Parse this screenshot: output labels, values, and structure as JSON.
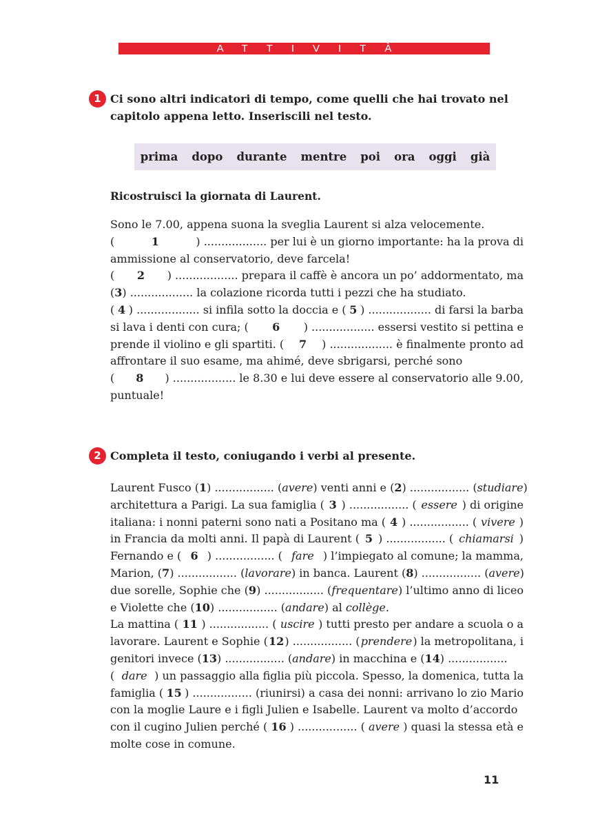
{
  "header": {
    "banner": "ATTIVITÀ"
  },
  "exercise1": {
    "number": "1",
    "title_line1": "Ci sono altri indicatori di tempo, come quelli che hai trovato nel",
    "title_line2": "capitolo appena letto. Inseriscili nel testo.",
    "words": [
      "prima",
      "dopo",
      "durante",
      "mentre",
      "poi",
      "ora",
      "oggi",
      "già"
    ],
    "subtitle": "Ricostruisci la giornata di Laurent.",
    "text_lines": [
      "Sono le 7.00, appena suona la sveglia Laurent si alza velocemente.",
      "(1) .................. per lui è un giorno importante: ha la prova di",
      "ammissione al conservatorio, deve farcela!",
      "(2) .................. prepara il caffè è ancora un po’ addormentato, ma",
      "(3) .................. la colazione ricorda tutti i pezzi che ha studiato.",
      "(4) .................. si infila sotto la doccia e (5) .................. di farsi la barba",
      "si lava i denti con cura; (6) .................. essersi vestito si pettina e",
      "prende il violino e gli spartiti. (7) .................. è finalmente pronto ad",
      "affrontare il suo esame, ma ahimé, deve sbrigarsi, perché sono",
      "(8) .................. le 8.30 e lui deve essere al conservatorio alle 9.00,",
      "puntuale!"
    ]
  },
  "exercise2": {
    "number": "2",
    "title": "Completa il testo, coniugando i verbi al presente.",
    "text_lines": [
      "Laurent Fusco (1) ................. (avere) venti anni e (2) ................. (studiare)",
      "architettura a Parigi. La sua famiglia (3) ................. (essere) di origine",
      "italiana: i nonni paterni sono nati a Positano ma (4) ................. (vivere)",
      "in Francia da molti anni. Il papà di Laurent (5) ................. (chiamarsi)",
      "Fernando e (6) ................. (fare) l’impiegato al comune; la mamma,",
      "Marion, (7) ................. (lavorare) in banca. Laurent (8) ................. (avere)",
      "due sorelle, Sophie che (9) ................. (frequentare) l’ultimo anno di liceo",
      "e Violette che (10) ................. (andare) al collège.",
      "La mattina (11) ................. (uscire) tutti presto per andare a scuola o a",
      "lavorare. Laurent e Sophie (12) ................. (prendere) la metropolitana, i",
      "genitori invece (13) ................. (andare) in macchina e (14) .................",
      "(dare) un passaggio alla figlia più piccola. Spesso, la domenica, tutta la",
      "famiglia (15) ................. (riunirsi) a casa dei nonni: arrivano lo zio Mario",
      "con la moglie Laure e i figli Julien e Isabelle. Laurent va molto d’accordo",
      "con il cugino Julien perché (16) ................. (avere) quasi la stessa età e",
      "molte cose in comune."
    ]
  },
  "footer": {
    "page_number": "11"
  },
  "colors": {
    "accent": "#e4232f",
    "word_box_bg": "#e8e1ee",
    "text": "#222222"
  }
}
